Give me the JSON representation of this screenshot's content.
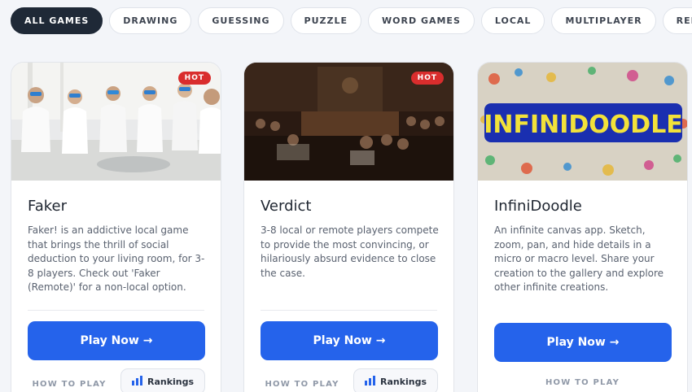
{
  "filters": [
    {
      "label": "ALL GAMES",
      "active": true
    },
    {
      "label": "DRAWING",
      "active": false
    },
    {
      "label": "GUESSING",
      "active": false
    },
    {
      "label": "PUZZLE",
      "active": false
    },
    {
      "label": "WORD GAMES",
      "active": false
    },
    {
      "label": "LOCAL",
      "active": false
    },
    {
      "label": "MULTIPLAYER",
      "active": false
    },
    {
      "label": "REMOTE",
      "active": false
    }
  ],
  "cards": [
    {
      "title": "Faker",
      "badge": "HOT",
      "description": "Faker! is an addictive local game that brings the thrill of social deduction to your living room, for 3-8 players. Check out 'Faker (Remote)' for a non-local option.",
      "play_label": "Play Now →",
      "how_to_label": "HOW TO PLAY",
      "rankings_label": "Rankings"
    },
    {
      "title": "Verdict",
      "badge": "HOT",
      "description": "3-8 local or remote players compete to provide the most convincing, or hilariously absurd evidence to close the case.",
      "play_label": "Play Now →",
      "how_to_label": "HOW TO PLAY",
      "rankings_label": "Rankings"
    },
    {
      "title": "InfiniDoodle",
      "logo_text": "INFINIDOODLE",
      "description": "An infinite canvas app. Sketch, zoom, pan, and hide details in a micro or macro level. Share your creation to the gallery and explore other infinite creations.",
      "play_label": "Play Now →",
      "how_to_label": "HOW TO PLAY"
    }
  ],
  "colors": {
    "accent": "#2563eb",
    "badge": "#d92d2d",
    "active_chip": "#1f2937"
  }
}
